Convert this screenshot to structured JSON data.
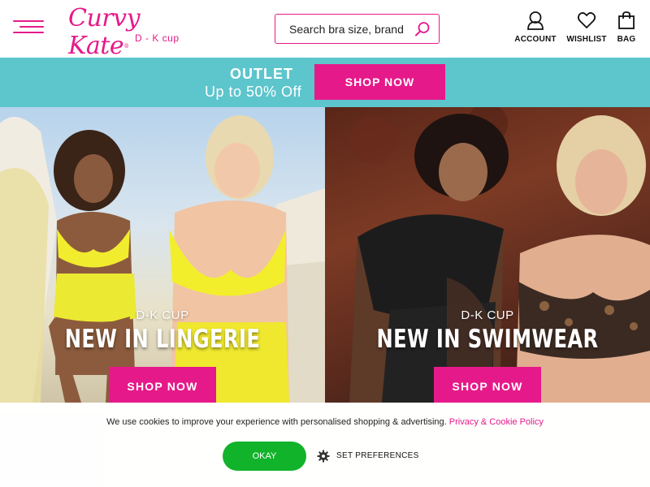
{
  "header": {
    "logo": {
      "brand": "Curvy Kate",
      "tagline": "D - K cup"
    },
    "search": {
      "placeholder": "Search bra size, brand"
    },
    "actions": [
      {
        "label": "ACCOUNT",
        "icon": "account-icon"
      },
      {
        "label": "WISHLIST",
        "icon": "heart-icon"
      },
      {
        "label": "BAG",
        "icon": "bag-icon"
      }
    ]
  },
  "promo": {
    "title": "OUTLET",
    "subtitle": "Up to 50% Off",
    "button": "SHOP NOW"
  },
  "heroes": [
    {
      "kicker": "D-K CUP",
      "headline": "NEW IN LINGERIE",
      "button": "SHOP NOW"
    },
    {
      "kicker": "D-K CUP",
      "headline": "NEW IN SWIMWEAR",
      "button": "SHOP NOW"
    }
  ],
  "cookie": {
    "message": "We use cookies to improve your experience with personalised shopping & advertising.",
    "link": "Privacy & Cookie Policy",
    "ok": "OKAY",
    "preferences": "SET PREFERENCES"
  },
  "colors": {
    "brand_pink": "#e6198a",
    "promo_teal": "#5dc5cc",
    "ok_green": "#11b32b"
  }
}
